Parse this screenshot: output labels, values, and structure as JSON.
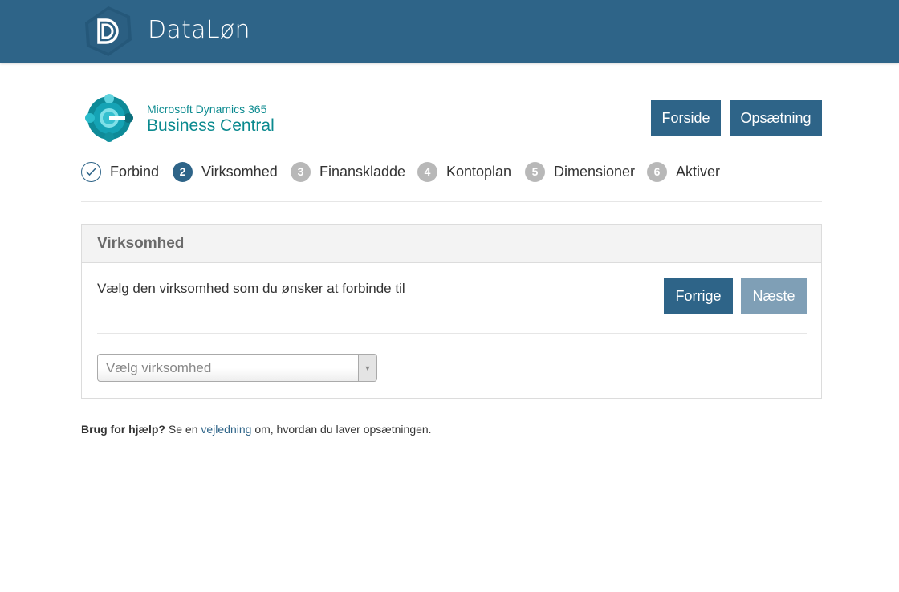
{
  "header": {
    "app_name": "DataLøn",
    "logo_icon": "datalon-d-logo-icon"
  },
  "product": {
    "small": "Microsoft Dynamics 365",
    "big": "Business Central",
    "logo_icon": "business-central-logo-icon"
  },
  "nav": {
    "forside": "Forside",
    "opsaetning": "Opsætning"
  },
  "steps": [
    {
      "num": "",
      "label": "Forbind",
      "state": "done"
    },
    {
      "num": "2",
      "label": "Virksomhed",
      "state": "active"
    },
    {
      "num": "3",
      "label": "Finanskladde",
      "state": "pending"
    },
    {
      "num": "4",
      "label": "Kontoplan",
      "state": "pending"
    },
    {
      "num": "5",
      "label": "Dimensioner",
      "state": "pending"
    },
    {
      "num": "6",
      "label": "Aktiver",
      "state": "pending"
    }
  ],
  "panel": {
    "title": "Virksomhed",
    "text": "Vælg den virksomhed som du ønsker at forbinde til",
    "prev_label": "Forrige",
    "next_label": "Næste",
    "select_placeholder": "Vælg virksomhed"
  },
  "help": {
    "bold": "Brug for hjælp?",
    "pre": " Se en ",
    "link": "vejledning",
    "post": " om, hvordan du laver opsætningen."
  },
  "colors": {
    "primary": "#2e6488",
    "disabled": "#7f9fb6",
    "teal": "#0b8a8f"
  }
}
